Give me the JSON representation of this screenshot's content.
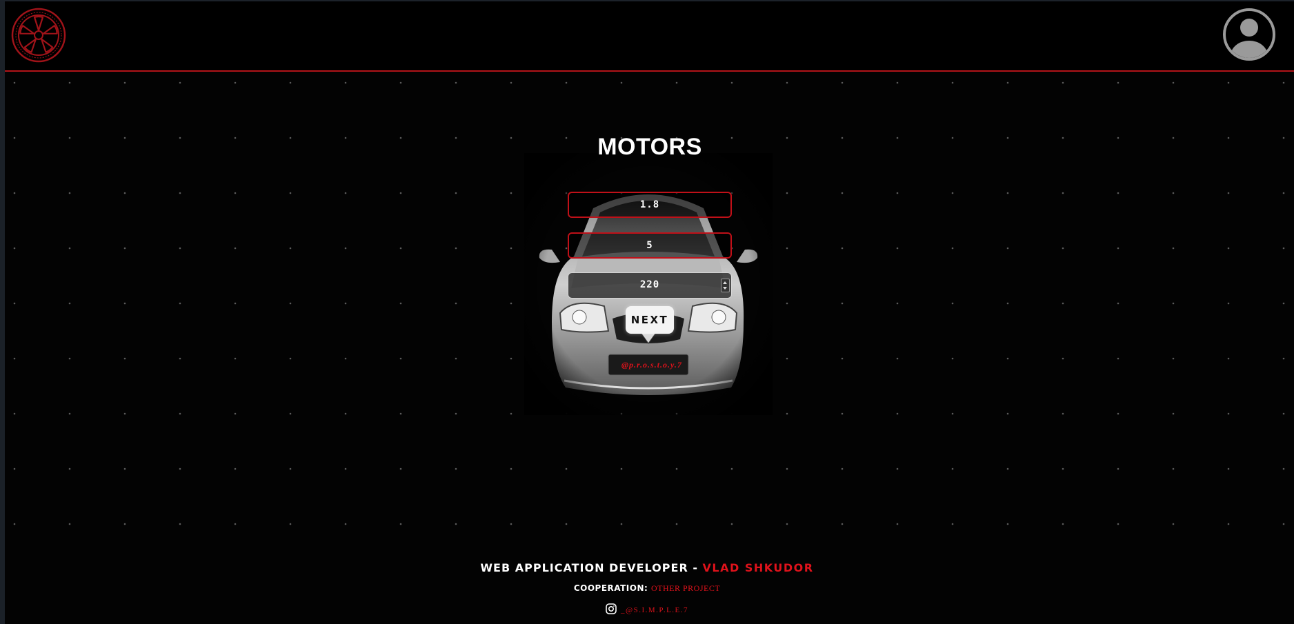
{
  "header": {
    "logo_icon": "wheel-rim-icon",
    "avatar_icon": "user-avatar-icon",
    "accent_color": "#b3141a"
  },
  "main": {
    "title": "MOTORS",
    "fields": [
      {
        "value": "1.8"
      },
      {
        "value": "5"
      },
      {
        "value": "220"
      }
    ],
    "next_label": "NEXT",
    "plate_text": "@p.r.o.s.t.o.y.7"
  },
  "footer": {
    "developer_label": "WEB APPLICATION DEVELOPER - ",
    "developer_name": "VLAD SHKUDOR",
    "cooperation_label": "COOPERATION: ",
    "cooperation_link": "OTHER PROJECT",
    "instagram_icon": "instagram-icon",
    "instagram_handle": "_@S.I.M.P.L.E.7"
  }
}
